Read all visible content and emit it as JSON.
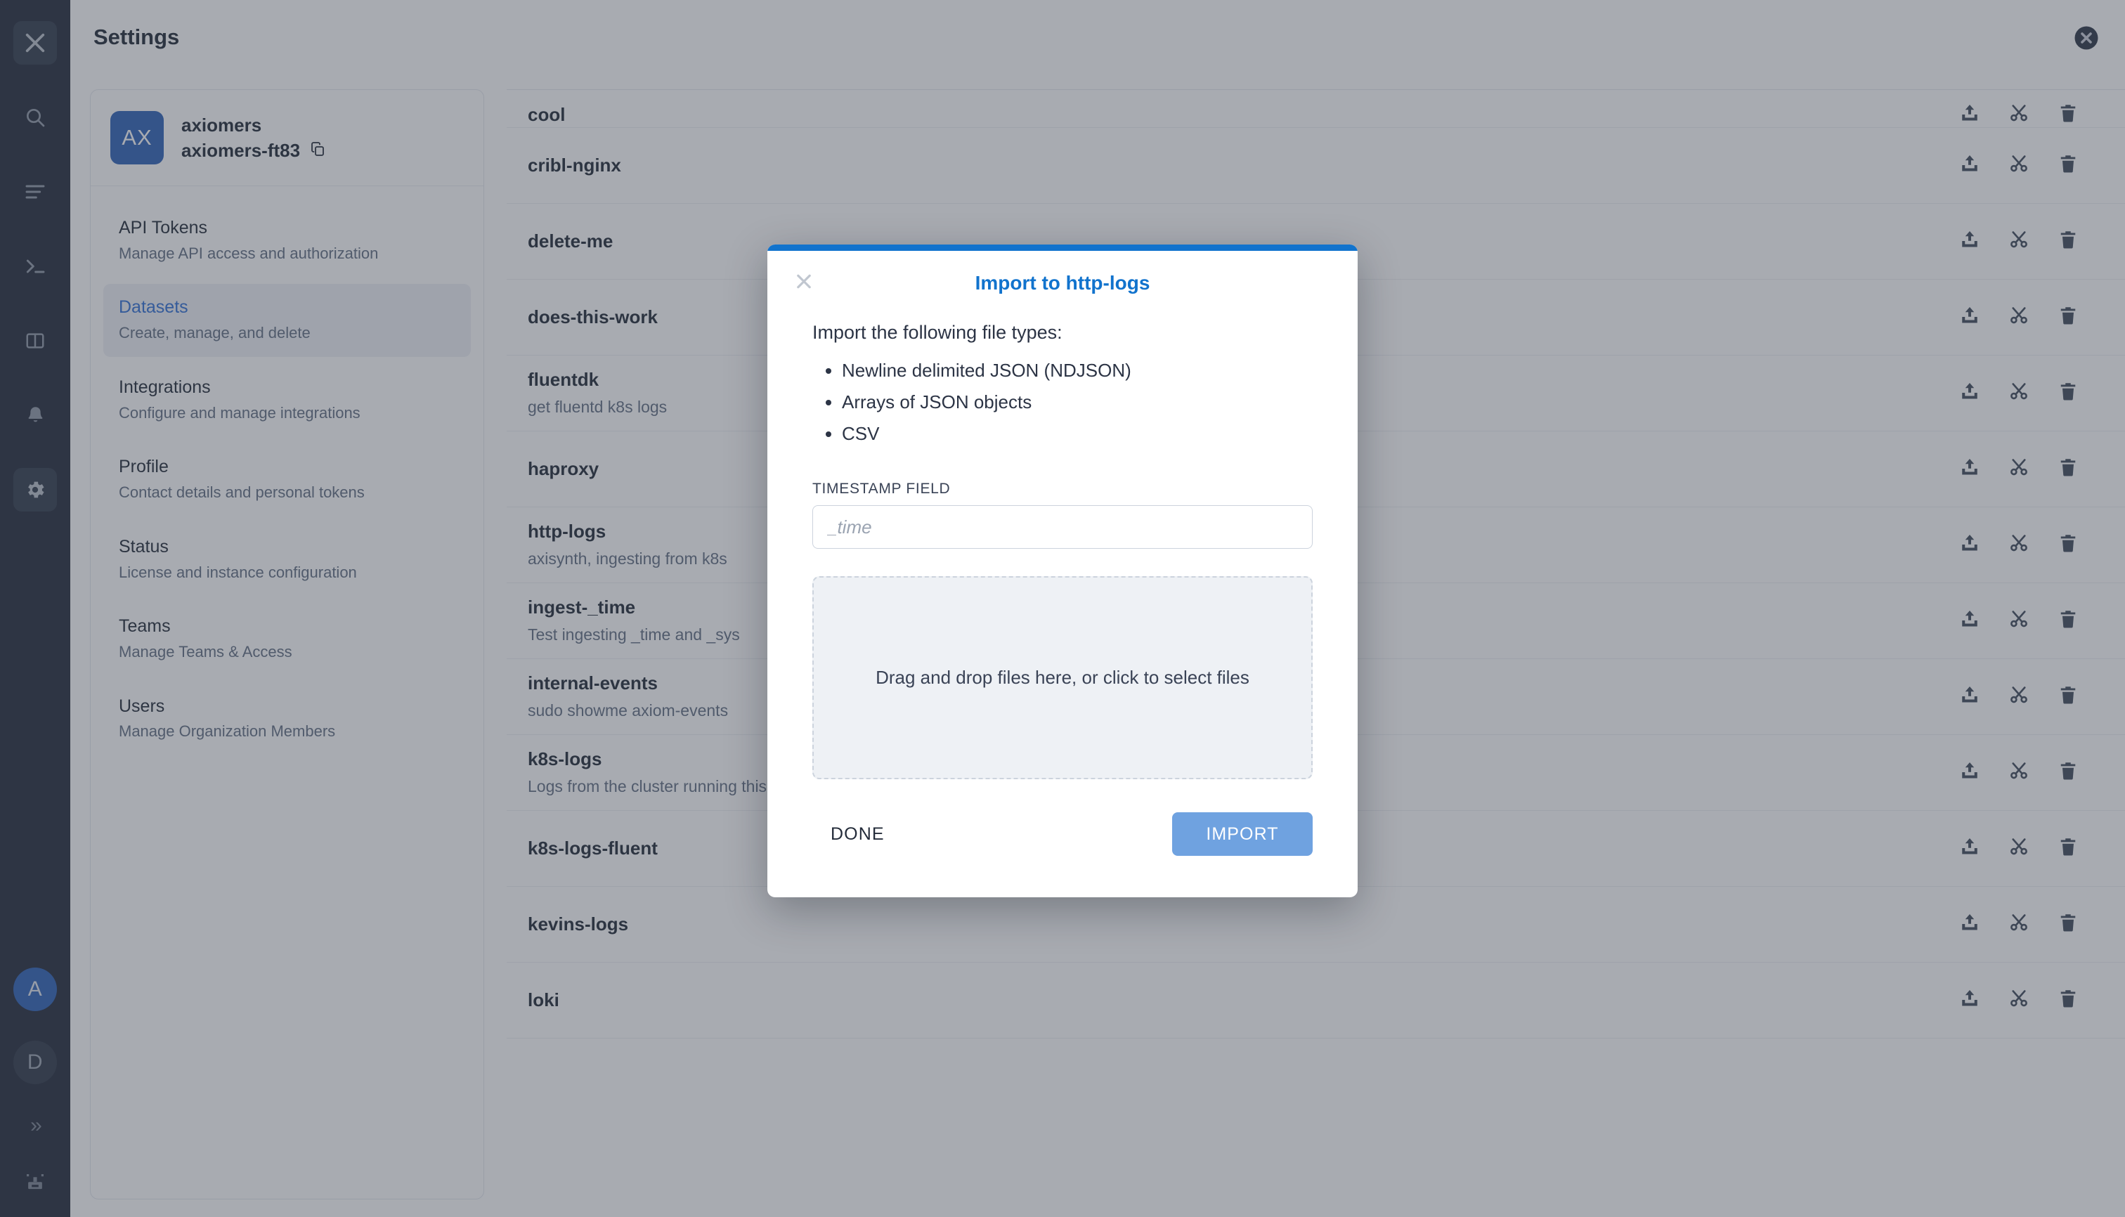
{
  "nav_rail": {
    "items": [
      {
        "name": "logo",
        "icon": "axiom-logo-icon",
        "active": true
      },
      {
        "name": "search",
        "icon": "search-icon",
        "active": false
      },
      {
        "name": "stream",
        "icon": "stream-icon",
        "active": false
      },
      {
        "name": "query",
        "icon": "terminal-icon",
        "active": false
      },
      {
        "name": "dashboards",
        "icon": "dashboard-icon",
        "active": false
      },
      {
        "name": "monitors",
        "icon": "bell-icon",
        "active": false
      },
      {
        "name": "settings",
        "icon": "gear-icon",
        "active": true
      }
    ],
    "avatars": [
      {
        "initial": "A",
        "color": "#2a5eb5"
      },
      {
        "initial": "D",
        "color": "#2b3445"
      }
    ],
    "expand_glyph": "»",
    "bot_icon": "robot-icon"
  },
  "header": {
    "title": "Settings",
    "close_icon": "close-circle-icon"
  },
  "settings_panel": {
    "org": {
      "logo_initials": "AX",
      "name": "axiomers",
      "id": "axiomers-ft83",
      "copy_icon": "copy-icon"
    },
    "items": [
      {
        "title": "API Tokens",
        "sub": "Manage API access and authorization",
        "active": false
      },
      {
        "title": "Datasets",
        "sub": "Create, manage, and delete",
        "active": true
      },
      {
        "title": "Integrations",
        "sub": "Configure and manage integrations",
        "active": false
      },
      {
        "title": "Profile",
        "sub": "Contact details and personal tokens",
        "active": false
      },
      {
        "title": "Status",
        "sub": "License and instance configuration",
        "active": false
      },
      {
        "title": "Teams",
        "sub": "Manage Teams & Access",
        "active": false
      },
      {
        "title": "Users",
        "sub": "Manage Organization Members",
        "active": false
      }
    ]
  },
  "datasets": {
    "row_actions": [
      {
        "name": "import-action",
        "icon": "upload-icon"
      },
      {
        "name": "trim-action",
        "icon": "scissors-icon"
      },
      {
        "name": "delete-action",
        "icon": "trash-icon"
      }
    ],
    "rows": [
      {
        "name": "cool",
        "desc": "",
        "clipped": true
      },
      {
        "name": "cribl-nginx",
        "desc": ""
      },
      {
        "name": "delete-me",
        "desc": ""
      },
      {
        "name": "does-this-work",
        "desc": ""
      },
      {
        "name": "fluentdk",
        "desc": "get fluentd k8s logs"
      },
      {
        "name": "haproxy",
        "desc": ""
      },
      {
        "name": "http-logs",
        "desc": "axisynth, ingesting from k8s"
      },
      {
        "name": "ingest-_time",
        "desc": "Test ingesting _time and _sys"
      },
      {
        "name": "internal-events",
        "desc": "sudo showme axiom-events"
      },
      {
        "name": "k8s-logs",
        "desc": "Logs from the cluster running this"
      },
      {
        "name": "k8s-logs-fluent",
        "desc": ""
      },
      {
        "name": "kevins-logs",
        "desc": ""
      },
      {
        "name": "loki",
        "desc": ""
      }
    ]
  },
  "modal": {
    "accent_color": "#1173cd",
    "close_icon": "axiom-close-icon",
    "title": "Import to http-logs",
    "lead": "Import the following file types:",
    "file_types": [
      "Newline delimited JSON (NDJSON)",
      "Arrays of JSON objects",
      "CSV"
    ],
    "timestamp_label": "TIMESTAMP FIELD",
    "timestamp_value": "",
    "timestamp_placeholder": "_time",
    "dropzone_text": "Drag and drop files here, or click to select files",
    "done_label": "DONE",
    "import_label": "IMPORT",
    "import_color": "#6fa2e0"
  }
}
